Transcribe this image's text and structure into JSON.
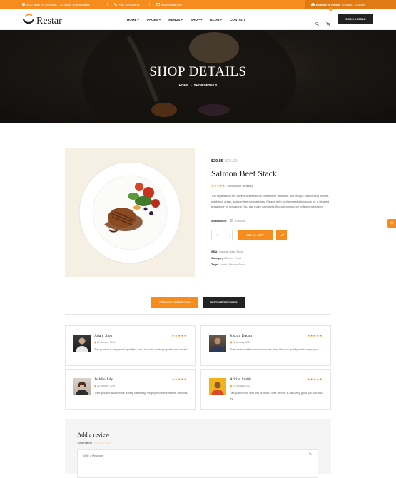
{
  "topbar": {
    "address": "9402 Main St, Plymouth, CA 95669, United States",
    "phone": "+987-629-18615",
    "email": "info@restar.com",
    "hours_label": "Monday to Friday:",
    "hours_value": "9:00am - 22:00pm",
    "icons": [
      "location-pin-icon",
      "phone-icon",
      "email-icon",
      "clock-icon"
    ]
  },
  "header": {
    "logo": "Restar",
    "nav": [
      "HOME",
      "PAGES",
      "MENUS",
      "SHOP",
      "BLOG",
      "CONTACT"
    ],
    "cart_count": "0",
    "book_button": "BOOK A TABLE"
  },
  "hero": {
    "title": "SHOP DETAILS",
    "breadcrumb_home": "HOME",
    "breadcrumb_sep": "›",
    "breadcrumb_current": "SHOP DETAILS"
  },
  "product": {
    "price": "$20.85",
    "old_price": "$25.99",
    "name": "Salmon Beef Stack",
    "rating": 5,
    "stars": "★★★★★",
    "reviews": "(4 customer reviews)",
    "description": "The registration fee covers access to all conference sessions, workshops, networking events, exhibition areas, and conference materials. Please refer to the registration page for a detailed breakdown of inclusions. You can make payments through our secure online registration.",
    "availability_label": "Availability:",
    "availability_value": "In Stock",
    "quantity": "1",
    "add_to_cart": "ADD TO CART",
    "sku_label": "SKU:",
    "sku_value": "Salmon-Beef-Stack",
    "category_label": "Category:",
    "category_value": "Dinner Food",
    "tags_label": "Tags:",
    "tags_value": "Lunch, Dinner, Food"
  },
  "tabs": [
    "PRODUCT DESCRIPTION",
    "CUSTOMER REVIEWS"
  ],
  "reviews": [
    {
      "name": "Adam Jhon",
      "date": "22 January, 2024",
      "stars": "★★★★★",
      "text": "This product is very much qualityful and I love this working system and speed."
    },
    {
      "name": "Jusctin Dacon",
      "date": "28 January, 2024",
      "stars": "★★★★★",
      "text": "They delivered the product in a few time. Product quality is also very good."
    },
    {
      "name": "Jacklin July",
      "date": "26 January, 2024",
      "stars": "★★★★★",
      "text": "Their product and service is very satisfying. I highly recommend their services."
    },
    {
      "name": "Adrian Smith",
      "date": "24 January, 2024",
      "stars": "★★★★★",
      "text": "I am just in love with this product. Their service is also very good you can also try."
    }
  ],
  "review_form": {
    "title": "Add a review",
    "rating_label": "Your Rating",
    "rating_stars": "☆☆☆☆☆",
    "message_placeholder": "Write a Message"
  },
  "colors": {
    "accent": "#f68b1e",
    "dark": "#222222",
    "hero_bg": "#2b2520"
  }
}
